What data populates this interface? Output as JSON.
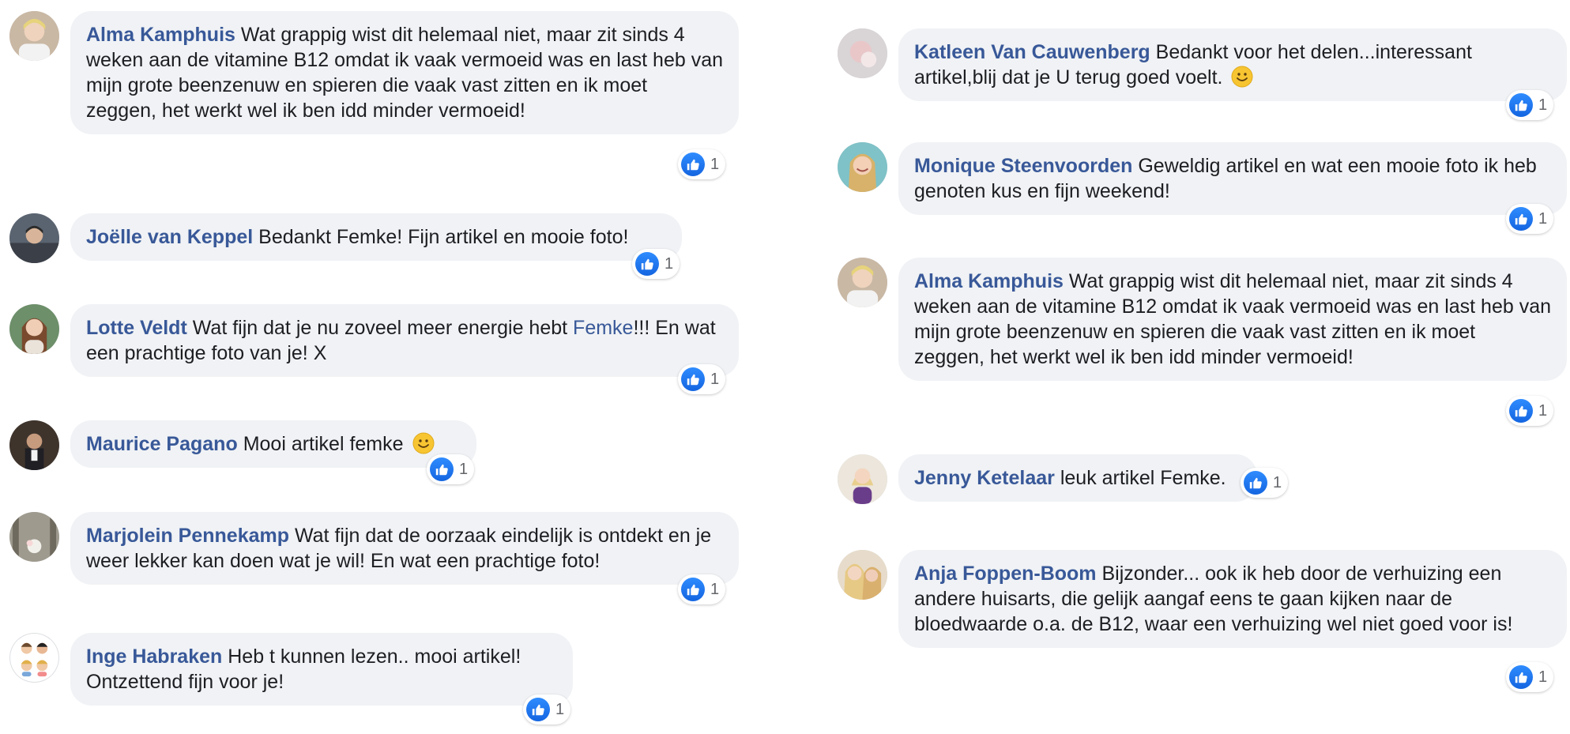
{
  "colors": {
    "name": "#385898",
    "bubble": "#f0f2f5",
    "like": "#1877f2",
    "text": "#1c1e21"
  },
  "icons": {
    "like": "thumbs-up-icon",
    "emoji": "smiley-emoji-icon"
  },
  "comments": [
    {
      "author": "Alma Kamphuis",
      "text": "Wat grappig wist dit helemaal niet, maar zit sinds 4 weken aan de vitamine B12 omdat ik vaak vermoeid was en last heb van mijn grote beenzenuw en spieren die vaak vast zitten en ik moet zeggen, het werkt wel ik ben idd minder vermoeid!",
      "likes": "1"
    },
    {
      "author": "Joëlle van Keppel",
      "text": "Bedankt Femke! Fijn artikel en mooie foto!",
      "likes": "1"
    },
    {
      "author": "Lotte Veldt",
      "text": "Wat fijn dat je nu zoveel meer energie hebt",
      "mention": "Femke",
      "text_after": "!!! En wat een prachtige foto van je! X",
      "likes": "1"
    },
    {
      "author": "Maurice Pagano",
      "text": "Mooi artikel femke",
      "likes": "1"
    },
    {
      "author": "Marjolein Pennekamp",
      "text": "Wat fijn dat de oorzaak eindelijk is ontdekt en je weer lekker kan doen wat je wil! En wat een prachtige foto!",
      "likes": "1"
    },
    {
      "author": "Inge Habraken",
      "text": "Heb t kunnen lezen.. mooi artikel! Ontzettend fijn voor je!",
      "likes": "1"
    },
    {
      "author": "Katleen Van Cauwenberg",
      "text": "Bedankt voor het delen...interessant artikel,blij dat je U terug goed voelt.",
      "likes": "1"
    },
    {
      "author": "Monique Steenvoorden",
      "text": "Geweldig artikel en wat een mooie foto ik heb genoten kus en fijn weekend!",
      "likes": "1"
    },
    {
      "author": "Alma Kamphuis",
      "text": "Wat grappig wist dit helemaal niet, maar zit sinds 4 weken aan de vitamine B12 omdat ik vaak vermoeid was en last heb van mijn grote beenzenuw en spieren die vaak vast zitten en ik moet zeggen, het werkt wel ik ben idd minder vermoeid!",
      "likes": "1"
    },
    {
      "author": "Jenny Ketelaar",
      "text": "leuk artikel Femke.",
      "likes": "1"
    },
    {
      "author": "Anja Foppen-Boom",
      "text": "Bijzonder... ook ik heb door de verhuizing een andere huisarts, die gelijk aangaf eens te gaan kijken naar de bloedwaarde o.a. de B12, waar een verhuizing wel niet goed voor is!",
      "likes": "1"
    }
  ]
}
